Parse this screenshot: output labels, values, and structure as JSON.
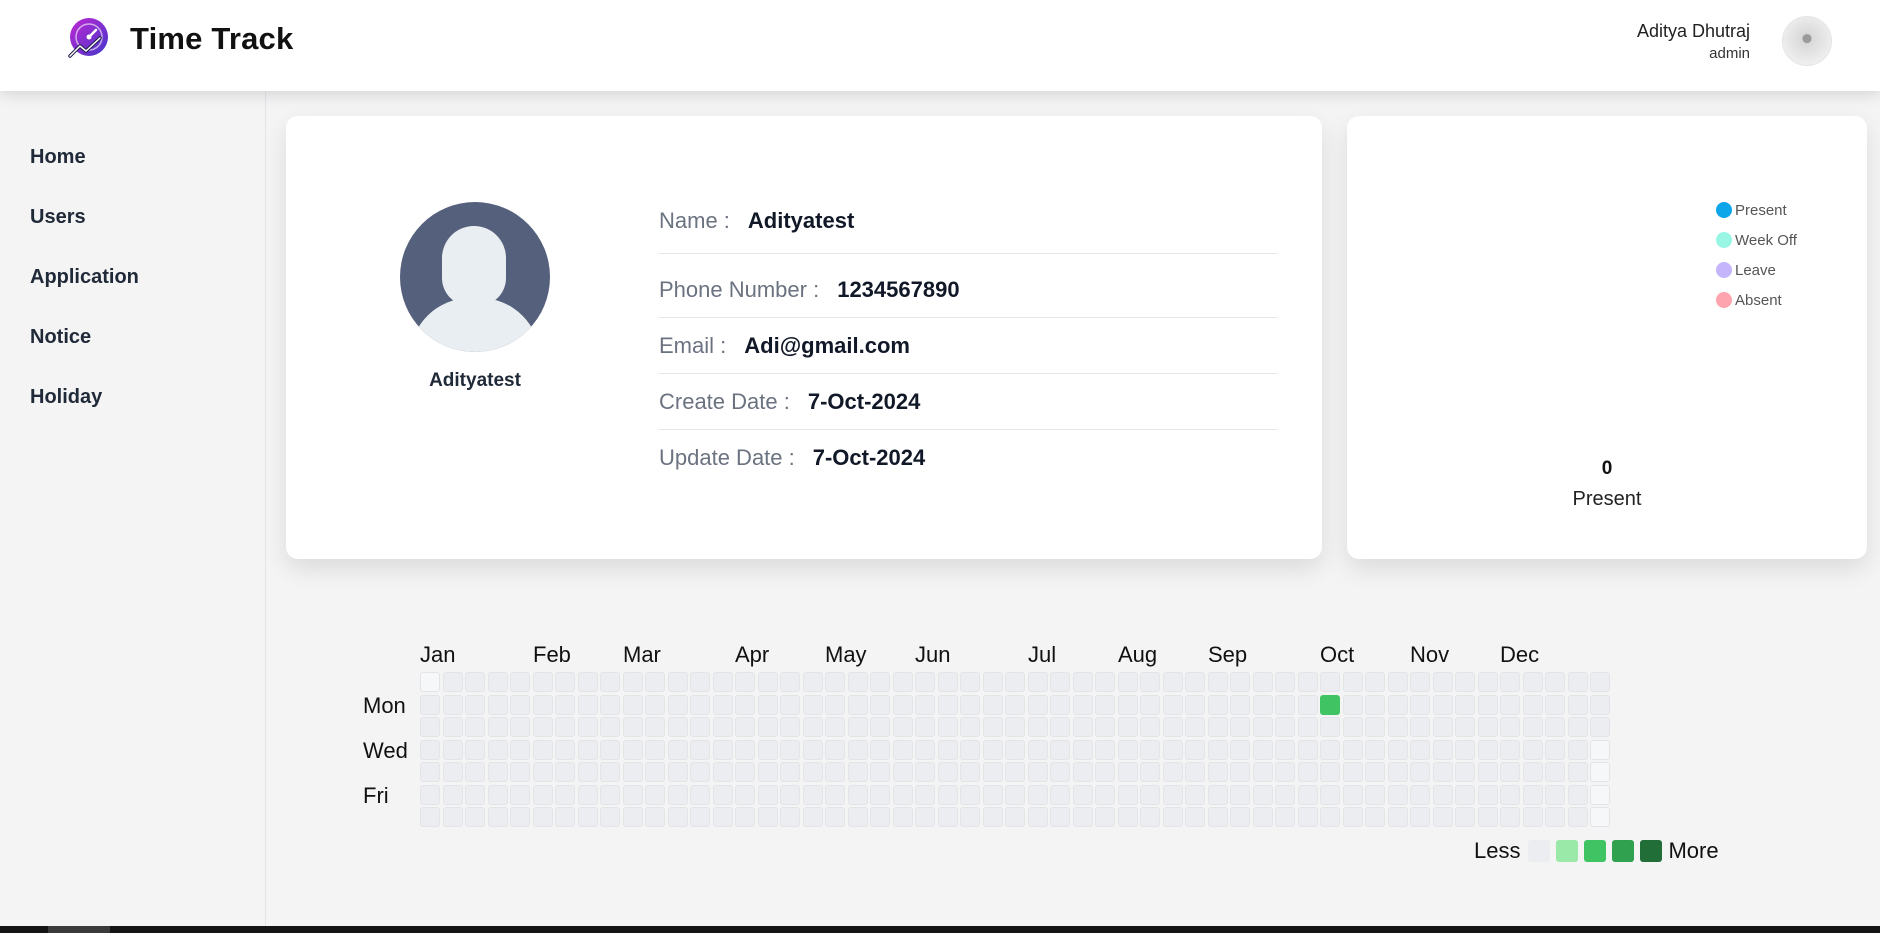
{
  "app": {
    "title": "Time Track"
  },
  "user": {
    "name": "Aditya Dhutraj",
    "role": "admin"
  },
  "sidebar": {
    "items": [
      {
        "label": "Home"
      },
      {
        "label": "Users"
      },
      {
        "label": "Application"
      },
      {
        "label": "Notice"
      },
      {
        "label": "Holiday"
      }
    ]
  },
  "profile": {
    "display_name": "Adityatest",
    "fields": [
      {
        "label": "Name :",
        "value": "Adityatest"
      },
      {
        "label": "Phone Number :",
        "value": "1234567890"
      },
      {
        "label": "Email :",
        "value": "Adi@gmail.com"
      },
      {
        "label": "Create Date :",
        "value": "7-Oct-2024"
      },
      {
        "label": "Update Date :",
        "value": "7-Oct-2024"
      }
    ]
  },
  "stats": {
    "legend": [
      {
        "label": "Present",
        "color": "#0ea5e9"
      },
      {
        "label": "Week Off",
        "color": "#99f6e4"
      },
      {
        "label": "Leave",
        "color": "#c4b5fd"
      },
      {
        "label": "Absent",
        "color": "#fda4af"
      }
    ],
    "count": "0",
    "count_label": "Present"
  },
  "heatmap": {
    "months": [
      "Jan",
      "Feb",
      "Mar",
      "Apr",
      "May",
      "Jun",
      "Jul",
      "Aug",
      "Sep",
      "Oct",
      "Nov",
      "Dec"
    ],
    "days": [
      "Mon",
      "Wed",
      "Fri"
    ],
    "less_label": "Less",
    "more_label": "More",
    "scale_colors": [
      "#ebedf0",
      "#9be9a8",
      "#40c463",
      "#30a14e",
      "#216e39"
    ],
    "active_cells": [
      {
        "date": "7-Oct-2024",
        "level": 2
      }
    ]
  }
}
